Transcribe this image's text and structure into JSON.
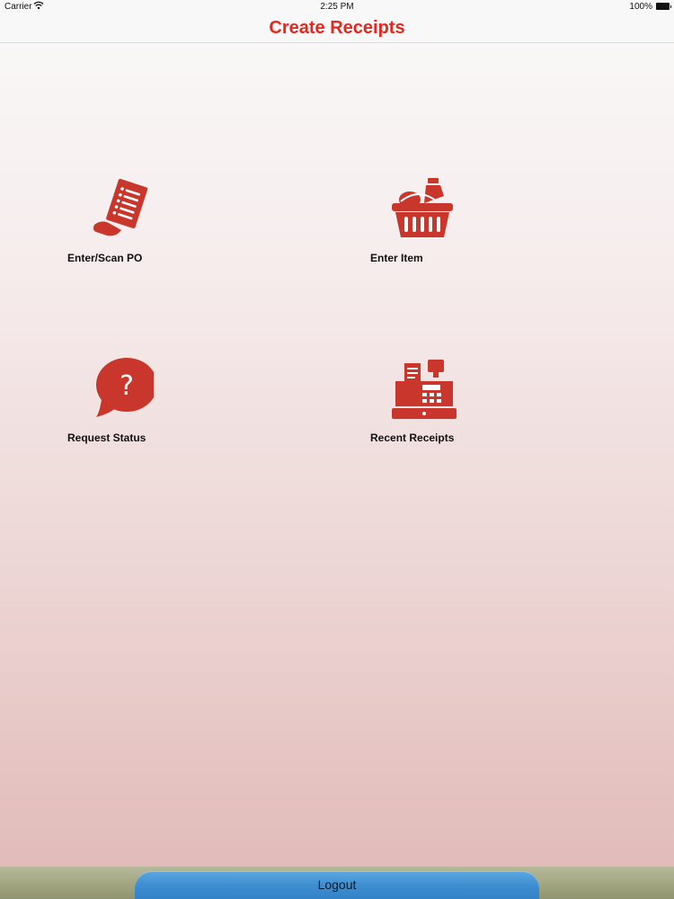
{
  "status_bar": {
    "carrier": "Carrier",
    "time": "2:25 PM",
    "battery": "100%"
  },
  "nav": {
    "title": "Create Receipts"
  },
  "tiles": [
    {
      "label": "Enter/Scan PO",
      "icon": "receipt-document-icon"
    },
    {
      "label": "Enter Item",
      "icon": "shopping-basket-icon"
    },
    {
      "label": "Request Status",
      "icon": "question-speech-bubble-icon"
    },
    {
      "label": "Recent Receipts",
      "icon": "cash-register-icon"
    }
  ],
  "footer": {
    "logout_label": "Logout"
  },
  "colors": {
    "accent": "#c9372c",
    "title": "#e8261d",
    "logout_button": "#3c8cd0"
  }
}
